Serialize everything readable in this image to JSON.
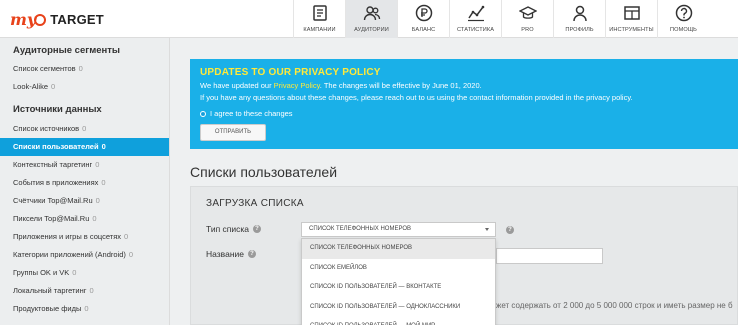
{
  "logo": {
    "my": "my",
    "target": "TARGET"
  },
  "nav": [
    {
      "label": "КАМПАНИИ",
      "icon": "campaigns-icon"
    },
    {
      "label": "АУДИТОРИИ",
      "icon": "audiences-icon"
    },
    {
      "label": "БАЛАНС",
      "icon": "ruble-icon"
    },
    {
      "label": "СТАТИСТИКА",
      "icon": "statistics-icon"
    },
    {
      "label": "PRO",
      "icon": "graduation-cap-icon"
    },
    {
      "label": "ПРОФИЛЬ",
      "icon": "profile-icon"
    },
    {
      "label": "ИНСТРУМЕНТЫ",
      "icon": "tools-icon"
    },
    {
      "label": "ПОМОЩЬ",
      "icon": "help-icon"
    }
  ],
  "sidebar": {
    "section1": "Аудиторные сегменты",
    "section1_items": [
      {
        "label": "Список сегментов",
        "count": "0"
      },
      {
        "label": "Look-Alike",
        "count": "0"
      }
    ],
    "section2": "Источники данных",
    "section2_items": [
      {
        "label": "Список источников",
        "count": "0"
      },
      {
        "label": "Списки пользователей",
        "count": "0"
      },
      {
        "label": "Контекстный таргетинг",
        "count": "0"
      },
      {
        "label": "События в приложениях",
        "count": "0"
      },
      {
        "label": "Счётчики Top@Mail.Ru",
        "count": "0"
      },
      {
        "label": "Пиксели Top@Mail.Ru",
        "count": "0"
      },
      {
        "label": "Приложения и игры в соцсетях",
        "count": "0"
      },
      {
        "label": "Категории приложений (Android)",
        "count": "0"
      },
      {
        "label": "Группы OK и VK",
        "count": "0"
      },
      {
        "label": "Локальный таргетинг",
        "count": "0"
      },
      {
        "label": "Продуктовые фиды",
        "count": "0"
      }
    ],
    "active_color": "#0fa0dc"
  },
  "privacy": {
    "title": "UPDATES TO OUR PRIVACY POLICY",
    "line1_prefix": "We have updated our ",
    "line1_link": "Privacy Policy",
    "line1_suffix": ". The changes will be effective by June 01, 2020.",
    "line2": "If you have any questions about these changes, please reach out to us using the contact information provided in the privacy policy.",
    "agree": "I agree to these changes",
    "send": "ОТПРАВИТЬ",
    "bg_color": "#1ab0e8",
    "accent": "#ffe93a"
  },
  "main": {
    "title": "Списки пользователей",
    "panel_title": "ЗАГРУЗКА СПИСКА",
    "type_label": "Тип списка",
    "type_value": "СПИСОК ТЕЛЕФОННЫХ НОМЕРОВ",
    "name_label": "Название",
    "dropdown_options": [
      "СПИСОК ТЕЛЕФОННЫХ НОМЕРОВ",
      "СПИСОК ЕМЕЙЛОВ",
      "СПИСОК ID ПОЛЬЗОВАТЕЛЕЙ — ВКОНТАКТЕ",
      "СПИСОК ID ПОЛЬЗОВАТЕЛЕЙ — ОДНОКЛАССНИКИ",
      "СПИСОК ID ПОЛЬЗОВАТЕЛЕЙ — МОЙ МИР"
    ],
    "hint": "жет содержать от 2 000 до 5 000 000 строк и иметь размер не б"
  }
}
